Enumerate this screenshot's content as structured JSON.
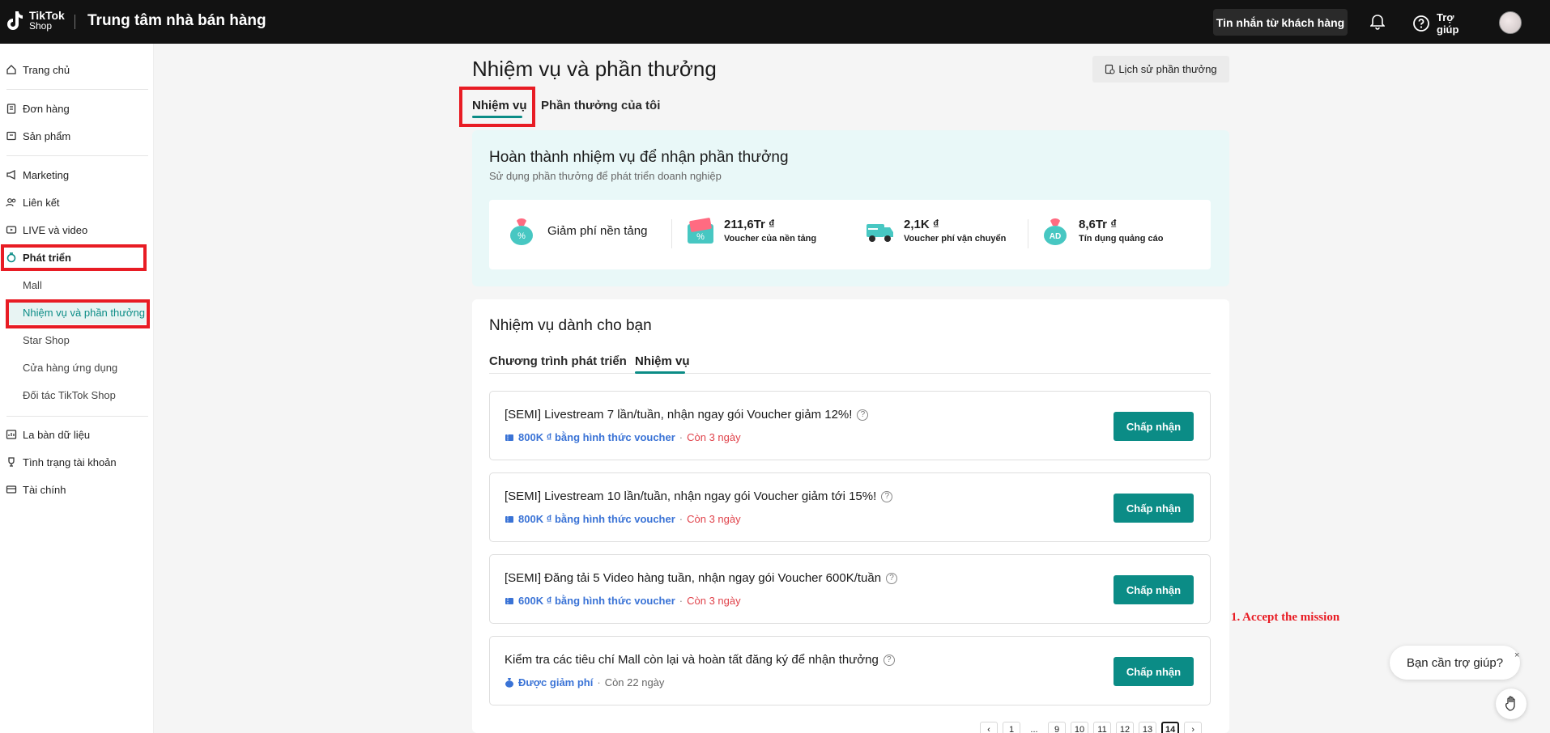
{
  "topbar": {
    "logo_main": "TikTok",
    "logo_sub": "Shop",
    "title": "Trung tâm nhà bán hàng",
    "messages_label": "Tin nhắn từ khách hàng",
    "help_label": "Trợ giúp"
  },
  "sidebar": {
    "items": [
      {
        "label": "Trang chủ",
        "icon": "home-icon"
      },
      {
        "label": "Đơn hàng",
        "icon": "clipboard-icon"
      },
      {
        "label": "Sản phẩm",
        "icon": "box-icon"
      },
      {
        "label": "Marketing",
        "icon": "megaphone-icon"
      },
      {
        "label": "Liên kết",
        "icon": "users-icon"
      },
      {
        "label": "LIVE và video",
        "icon": "video-icon"
      },
      {
        "label": "Phát triển",
        "icon": "growth-icon"
      },
      {
        "label": "Mall"
      },
      {
        "label": "Nhiệm vụ và phần thưởng"
      },
      {
        "label": "Star Shop"
      },
      {
        "label": "Cửa hàng ứng dụng"
      },
      {
        "label": "Đối tác TikTok Shop"
      },
      {
        "label": "La bàn dữ liệu",
        "icon": "chart-icon"
      },
      {
        "label": "Tình trạng tài khoản",
        "icon": "trophy-icon"
      },
      {
        "label": "Tài chính",
        "icon": "wallet-icon"
      }
    ]
  },
  "main": {
    "page_title": "Nhiệm vụ và phần thưởng",
    "history_button": "Lịch sử phần thưởng",
    "tabs": [
      "Nhiệm vụ",
      "Phần thưởng của tôi"
    ],
    "hero": {
      "title": "Hoàn thành nhiệm vụ để nhận phần thưởng",
      "subtitle": "Sử dụng phần thưởng để phát triển doanh nghiệp",
      "rewards": [
        {
          "value": "Giảm phí nền tảng",
          "label": ""
        },
        {
          "value": "211,6Tr ₫",
          "label": "Voucher của nền tảng"
        },
        {
          "value": "2,1K ₫",
          "label": "Voucher phí vận chuyển"
        },
        {
          "value": "8,6Tr ₫",
          "label": "Tín dụng quảng cáo"
        }
      ]
    },
    "missions": {
      "title": "Nhiệm vụ dành cho bạn",
      "tabs": [
        "Chương trình phát triển",
        "Nhiệm vụ"
      ],
      "items": [
        {
          "title": "[SEMI] Livestream 7 lần/tuần, nhận ngay gói Voucher giảm 12%!",
          "reward": "800K ₫ bằng hình thức voucher",
          "deadline": "Còn 3 ngày",
          "button": "Chấp nhận"
        },
        {
          "title": "[SEMI] Livestream 10 lần/tuần, nhận ngay gói Voucher giảm tới 15%!",
          "reward": "800K ₫ bằng hình thức voucher",
          "deadline": "Còn 3 ngày",
          "button": "Chấp nhận"
        },
        {
          "title": "[SEMI] Đăng tải 5 Video hàng tuần, nhận ngay gói Voucher 600K/tuần",
          "reward": "600K ₫ bằng hình thức voucher",
          "deadline": "Còn 3 ngày",
          "button": "Chấp nhận"
        },
        {
          "title": "Kiểm tra các tiêu chí Mall còn lại và hoàn tất đăng ký để nhận thưởng",
          "reward": "Được giảm phí",
          "deadline": "Còn 22 ngày",
          "button": "Chấp nhận"
        }
      ],
      "separator": "·"
    },
    "pagination": {
      "prev": "‹",
      "pages": [
        "1",
        "...",
        "9",
        "10",
        "11",
        "12",
        "13",
        "14"
      ],
      "current": "14",
      "next": "›"
    }
  },
  "annotation": "1. Accept the mission",
  "help_widget": {
    "bubble_text": "Bạn cần trợ giúp?",
    "close": "×"
  },
  "colors": {
    "accent": "#0b8c86",
    "highlight": "#e81c24",
    "reward_link": "#3a73d6",
    "deadline": "#e0424a"
  }
}
